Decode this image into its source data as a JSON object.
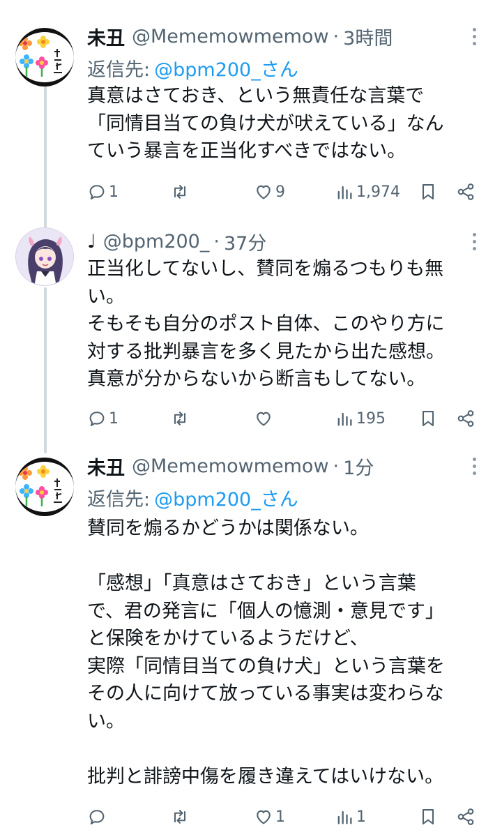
{
  "tweets": [
    {
      "display_name": "未丑",
      "handle": "@Mememowmemow",
      "separator": "·",
      "time": "3時間",
      "reply_label": "返信先:",
      "reply_mention": "@bpm200_さん",
      "body_lines": [
        "真意はさておき、という無責任な言葉で",
        "「同情目当ての負け犬が吠えている」なん",
        "ていう暴言を正当化すべきではない。"
      ],
      "actions": {
        "replies": "1",
        "retweets": "",
        "likes": "9",
        "views": "1,974"
      },
      "avatar_icon": "flower-signature-avatar"
    },
    {
      "display_name": "♩",
      "handle": "@bpm200_",
      "separator": "·",
      "time": "37分",
      "body_lines": [
        "正当化してないし、賛同を煽るつもりも無",
        "い。",
        "そもそも自分のポスト自体、このやり方に",
        "対する批判暴言を多く見たから出た感想。",
        "真意が分からないから断言もしてない。"
      ],
      "actions": {
        "replies": "1",
        "retweets": "",
        "likes": "",
        "views": "195"
      },
      "avatar_icon": "anime-character-avatar"
    },
    {
      "display_name": "未丑",
      "handle": "@Mememowmemow",
      "separator": "·",
      "time": "1分",
      "reply_label": "返信先:",
      "reply_mention": "@bpm200_さん",
      "body_lines": [
        "賛同を煽るかどうかは関係ない。",
        "",
        "「感想」「真意はさておき」という言葉",
        "で、君の発言に「個人の憶測・意見です」",
        "と保険をかけているようだけど、",
        "実際「同情目当ての負け犬」という言葉を",
        "その人に向けて放っている事実は変わらな",
        "い。",
        "",
        "批判と誹謗中傷を履き違えてはいけない。"
      ],
      "actions": {
        "replies": "",
        "retweets": "",
        "likes": "1",
        "views": "1"
      },
      "avatar_icon": "flower-signature-avatar"
    }
  ],
  "colors": {
    "text": "#0f1419",
    "secondary": "#536471",
    "link": "#1d9bf0",
    "thread_line": "#cfd9de"
  },
  "icons": [
    "reply-icon",
    "retweet-icon",
    "like-icon",
    "views-icon",
    "bookmark-icon",
    "share-icon",
    "more-icon"
  ]
}
